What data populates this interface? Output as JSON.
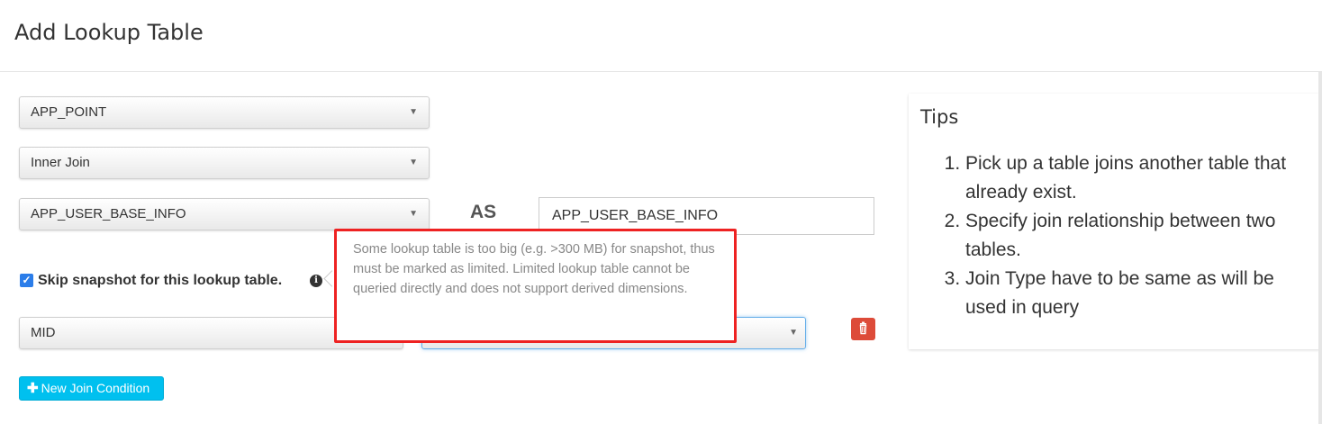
{
  "header": {
    "title": "Add Lookup Table"
  },
  "form": {
    "fact_table_value": "APP_POINT",
    "join_type_value": "Inner Join",
    "lookup_table_value": "APP_USER_BASE_INFO",
    "as_label": "AS",
    "alias_value": "APP_USER_BASE_INFO",
    "skip_snapshot_label": "Skip snapshot for this lookup table.",
    "skip_snapshot_checked": true,
    "join_left_column_value": "MID",
    "join_right_column_value": "",
    "new_join_label": "New Join Condition"
  },
  "tooltip": {
    "text": "Some lookup table is too big (e.g. >300 MB) for snapshot, thus must be marked as limited. Limited lookup table cannot be queried directly and does not support derived dimensions."
  },
  "tips": {
    "title": "Tips",
    "items": [
      "Pick up a table joins another table that already exist.",
      "Specify join relationship between two tables.",
      "Join Type have to be same as will be used in query"
    ]
  },
  "icons": {
    "caret": "caret-down-icon",
    "info": "info-circle-icon",
    "delete": "trash-icon",
    "plus": "plus-icon",
    "check": "checkmark-icon"
  },
  "colors": {
    "danger": "#dd4b39",
    "info_button": "#00c0ef",
    "checkbox": "#2b7de9",
    "highlight_border": "#ee2222",
    "focus_border": "#66afe9"
  }
}
